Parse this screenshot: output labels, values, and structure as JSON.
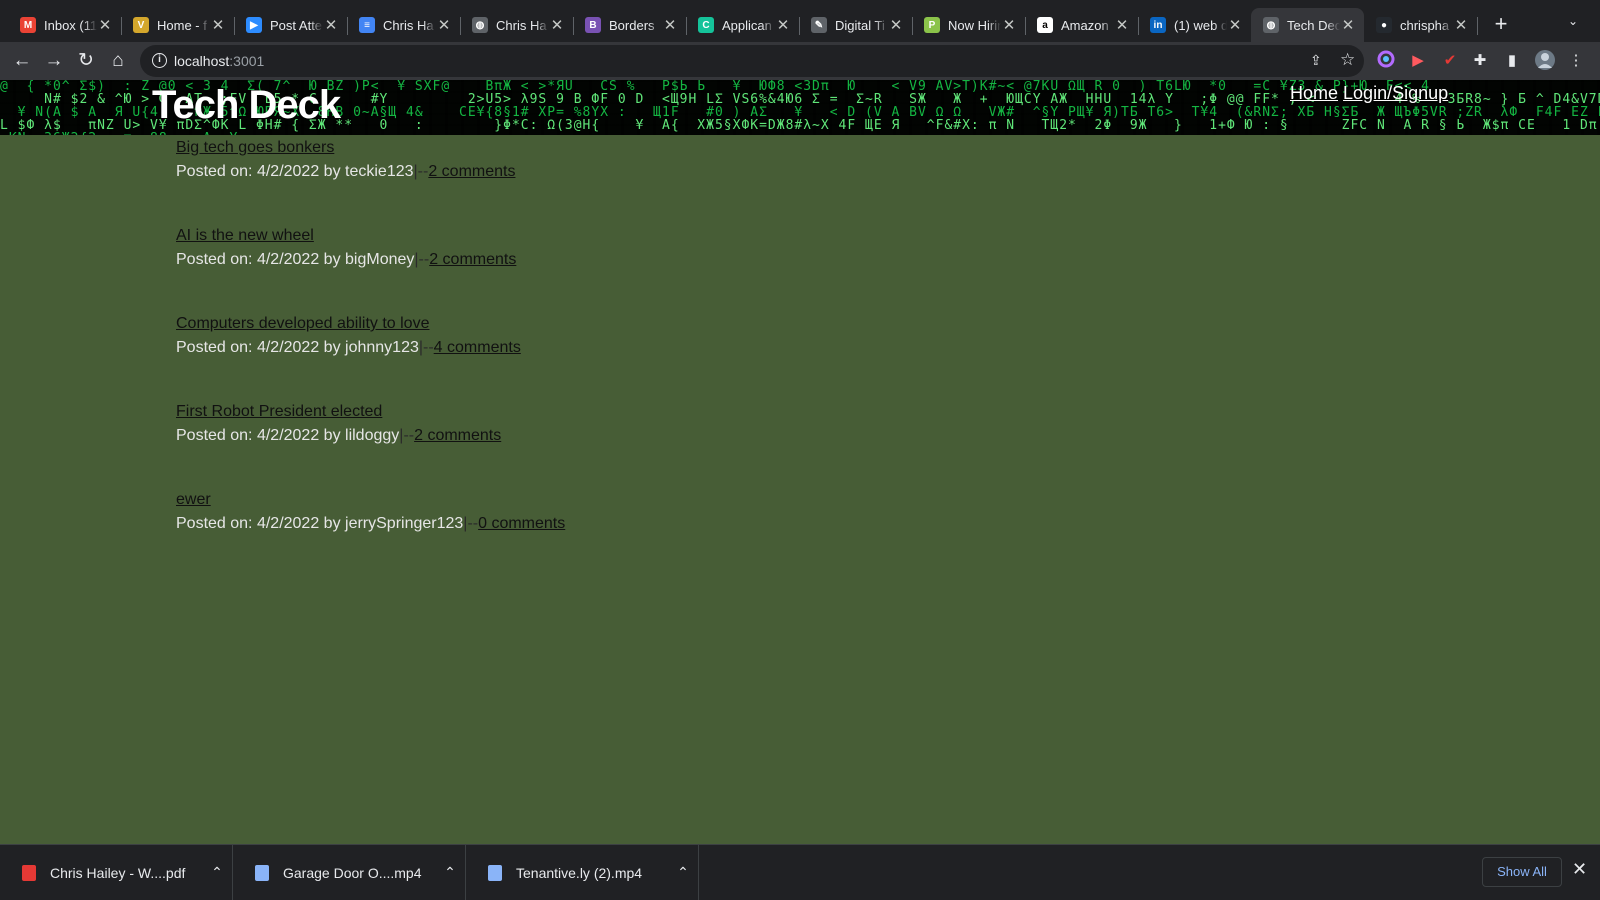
{
  "browser": {
    "tabs": [
      {
        "title": "Inbox (11",
        "favicon": "gmail-icon",
        "favicon_color": "#ea4335",
        "favicon_glyph": "M"
      },
      {
        "title": "Home - f",
        "favicon": "v-logo-icon",
        "favicon_color": "#d4a72c",
        "favicon_glyph": "V"
      },
      {
        "title": "Post Atte",
        "favicon": "zoom-icon",
        "favicon_color": "#2d8cff",
        "favicon_glyph": "▶"
      },
      {
        "title": "Chris Ha",
        "favicon": "google-docs-icon",
        "favicon_color": "#4285f4",
        "favicon_glyph": "≡"
      },
      {
        "title": "Chris Ha",
        "favicon": "globe-icon",
        "favicon_color": "#5f6368",
        "favicon_glyph": "◍"
      },
      {
        "title": "Borders",
        "favicon": "bootstrap-icon",
        "favicon_color": "#7952b3",
        "favicon_glyph": "B"
      },
      {
        "title": "Applican",
        "favicon": "grammarly-icon",
        "favicon_color": "#15c39a",
        "favicon_glyph": "C"
      },
      {
        "title": "Digital Ti",
        "favicon": "pen-icon",
        "favicon_color": "#5f6368",
        "favicon_glyph": "✎"
      },
      {
        "title": "Now Hirin",
        "favicon": "p-logo-icon",
        "favicon_color": "#8bc34a",
        "favicon_glyph": "P"
      },
      {
        "title": "Amazon",
        "favicon": "amazon-icon",
        "favicon_color": "#ffffff",
        "favicon_glyph": "a"
      },
      {
        "title": "(1) web d",
        "favicon": "linkedin-icon",
        "favicon_color": "#0a66c2",
        "favicon_glyph": "in"
      },
      {
        "title": "Tech Dec",
        "favicon": "globe-icon",
        "favicon_color": "#5f6368",
        "favicon_glyph": "◍",
        "active": true
      },
      {
        "title": "chrispha",
        "favicon": "github-icon",
        "favicon_color": "#24292f",
        "favicon_glyph": "●"
      }
    ],
    "address": {
      "host": "localhost",
      "port": ":3001"
    }
  },
  "site": {
    "title": "Tech Deck",
    "nav": {
      "home": "Home",
      "login": "Login/Signup"
    }
  },
  "posts": [
    {
      "title": "Big tech goes bonkers",
      "posted_prefix": "Posted on: 4/2/2022 by teckie123",
      "sep": "|--",
      "comments": "2 comments"
    },
    {
      "title": "AI is the new wheel",
      "posted_prefix": "Posted on: 4/2/2022 by bigMoney",
      "sep": "|--",
      "comments": "2 comments"
    },
    {
      "title": "Computers developed ability to love",
      "posted_prefix": "Posted on: 4/2/2022 by johnny123",
      "sep": "|--",
      "comments": "4 comments"
    },
    {
      "title": "First Robot President elected",
      "posted_prefix": "Posted on: 4/2/2022 by lildoggy",
      "sep": "|--",
      "comments": "2 comments"
    },
    {
      "title": "ewer",
      "posted_prefix": "Posted on: 4/2/2022 by jerrySpringer123",
      "sep": "|--",
      "comments": "0 comments"
    }
  ],
  "downloads": {
    "items": [
      {
        "name": "Chris Hailey - W....pdf",
        "icon": "pdf-icon",
        "color": "#e53935"
      },
      {
        "name": "Garage Door O....mp4",
        "icon": "file-icon",
        "color": "#8ab4f8"
      },
      {
        "name": "Tenantive.ly (2).mp4",
        "icon": "file-icon",
        "color": "#8ab4f8"
      }
    ],
    "show_all": "Show All"
  }
}
